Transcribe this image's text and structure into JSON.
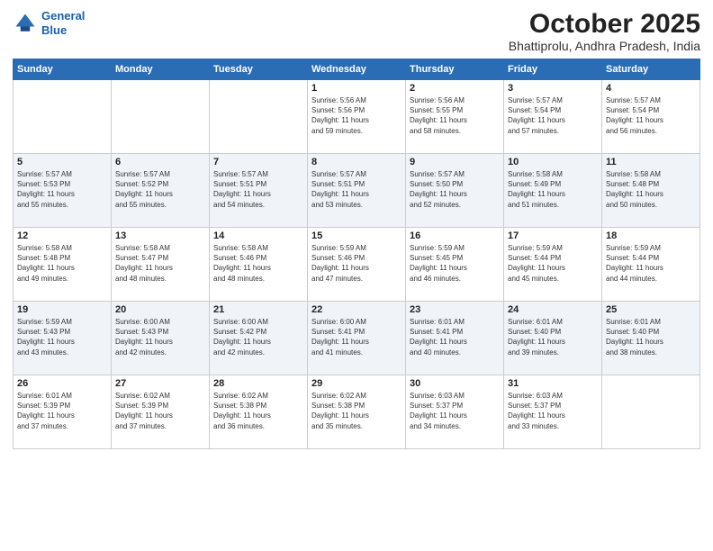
{
  "header": {
    "logo_line1": "General",
    "logo_line2": "Blue",
    "title": "October 2025",
    "subtitle": "Bhattiprolu, Andhra Pradesh, India"
  },
  "days_of_week": [
    "Sunday",
    "Monday",
    "Tuesday",
    "Wednesday",
    "Thursday",
    "Friday",
    "Saturday"
  ],
  "weeks": [
    [
      {
        "day": "",
        "info": ""
      },
      {
        "day": "",
        "info": ""
      },
      {
        "day": "",
        "info": ""
      },
      {
        "day": "1",
        "info": "Sunrise: 5:56 AM\nSunset: 5:56 PM\nDaylight: 11 hours\nand 59 minutes."
      },
      {
        "day": "2",
        "info": "Sunrise: 5:56 AM\nSunset: 5:55 PM\nDaylight: 11 hours\nand 58 minutes."
      },
      {
        "day": "3",
        "info": "Sunrise: 5:57 AM\nSunset: 5:54 PM\nDaylight: 11 hours\nand 57 minutes."
      },
      {
        "day": "4",
        "info": "Sunrise: 5:57 AM\nSunset: 5:54 PM\nDaylight: 11 hours\nand 56 minutes."
      }
    ],
    [
      {
        "day": "5",
        "info": "Sunrise: 5:57 AM\nSunset: 5:53 PM\nDaylight: 11 hours\nand 55 minutes."
      },
      {
        "day": "6",
        "info": "Sunrise: 5:57 AM\nSunset: 5:52 PM\nDaylight: 11 hours\nand 55 minutes."
      },
      {
        "day": "7",
        "info": "Sunrise: 5:57 AM\nSunset: 5:51 PM\nDaylight: 11 hours\nand 54 minutes."
      },
      {
        "day": "8",
        "info": "Sunrise: 5:57 AM\nSunset: 5:51 PM\nDaylight: 11 hours\nand 53 minutes."
      },
      {
        "day": "9",
        "info": "Sunrise: 5:57 AM\nSunset: 5:50 PM\nDaylight: 11 hours\nand 52 minutes."
      },
      {
        "day": "10",
        "info": "Sunrise: 5:58 AM\nSunset: 5:49 PM\nDaylight: 11 hours\nand 51 minutes."
      },
      {
        "day": "11",
        "info": "Sunrise: 5:58 AM\nSunset: 5:48 PM\nDaylight: 11 hours\nand 50 minutes."
      }
    ],
    [
      {
        "day": "12",
        "info": "Sunrise: 5:58 AM\nSunset: 5:48 PM\nDaylight: 11 hours\nand 49 minutes."
      },
      {
        "day": "13",
        "info": "Sunrise: 5:58 AM\nSunset: 5:47 PM\nDaylight: 11 hours\nand 48 minutes."
      },
      {
        "day": "14",
        "info": "Sunrise: 5:58 AM\nSunset: 5:46 PM\nDaylight: 11 hours\nand 48 minutes."
      },
      {
        "day": "15",
        "info": "Sunrise: 5:59 AM\nSunset: 5:46 PM\nDaylight: 11 hours\nand 47 minutes."
      },
      {
        "day": "16",
        "info": "Sunrise: 5:59 AM\nSunset: 5:45 PM\nDaylight: 11 hours\nand 46 minutes."
      },
      {
        "day": "17",
        "info": "Sunrise: 5:59 AM\nSunset: 5:44 PM\nDaylight: 11 hours\nand 45 minutes."
      },
      {
        "day": "18",
        "info": "Sunrise: 5:59 AM\nSunset: 5:44 PM\nDaylight: 11 hours\nand 44 minutes."
      }
    ],
    [
      {
        "day": "19",
        "info": "Sunrise: 5:59 AM\nSunset: 5:43 PM\nDaylight: 11 hours\nand 43 minutes."
      },
      {
        "day": "20",
        "info": "Sunrise: 6:00 AM\nSunset: 5:43 PM\nDaylight: 11 hours\nand 42 minutes."
      },
      {
        "day": "21",
        "info": "Sunrise: 6:00 AM\nSunset: 5:42 PM\nDaylight: 11 hours\nand 42 minutes."
      },
      {
        "day": "22",
        "info": "Sunrise: 6:00 AM\nSunset: 5:41 PM\nDaylight: 11 hours\nand 41 minutes."
      },
      {
        "day": "23",
        "info": "Sunrise: 6:01 AM\nSunset: 5:41 PM\nDaylight: 11 hours\nand 40 minutes."
      },
      {
        "day": "24",
        "info": "Sunrise: 6:01 AM\nSunset: 5:40 PM\nDaylight: 11 hours\nand 39 minutes."
      },
      {
        "day": "25",
        "info": "Sunrise: 6:01 AM\nSunset: 5:40 PM\nDaylight: 11 hours\nand 38 minutes."
      }
    ],
    [
      {
        "day": "26",
        "info": "Sunrise: 6:01 AM\nSunset: 5:39 PM\nDaylight: 11 hours\nand 37 minutes."
      },
      {
        "day": "27",
        "info": "Sunrise: 6:02 AM\nSunset: 5:39 PM\nDaylight: 11 hours\nand 37 minutes."
      },
      {
        "day": "28",
        "info": "Sunrise: 6:02 AM\nSunset: 5:38 PM\nDaylight: 11 hours\nand 36 minutes."
      },
      {
        "day": "29",
        "info": "Sunrise: 6:02 AM\nSunset: 5:38 PM\nDaylight: 11 hours\nand 35 minutes."
      },
      {
        "day": "30",
        "info": "Sunrise: 6:03 AM\nSunset: 5:37 PM\nDaylight: 11 hours\nand 34 minutes."
      },
      {
        "day": "31",
        "info": "Sunrise: 6:03 AM\nSunset: 5:37 PM\nDaylight: 11 hours\nand 33 minutes."
      },
      {
        "day": "",
        "info": ""
      }
    ]
  ]
}
